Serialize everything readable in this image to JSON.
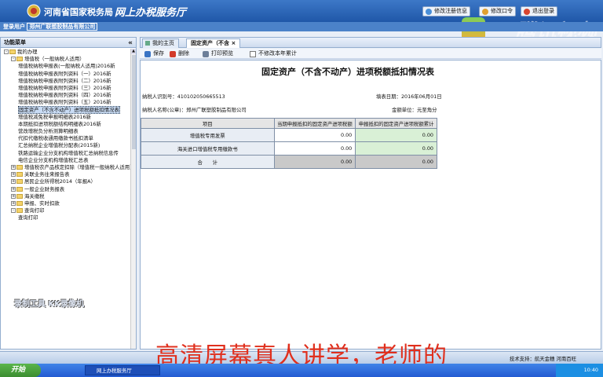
{
  "header": {
    "title1": "河南省国家税务局",
    "title2": "网上办税服务厅",
    "buttons": [
      "修改注册信息",
      "修改口令",
      "退出登录"
    ]
  },
  "user_bar": {
    "label": "登录用户",
    "company": "郑州广联塑胶制品有限公司"
  },
  "sidebar": {
    "title": "功能菜单",
    "items": [
      {
        "label": "我的办理",
        "level": 0,
        "type": "folder",
        "expand": "-"
      },
      {
        "label": "增值税（一般纳税人适用）",
        "level": 1,
        "type": "folder",
        "expand": "-"
      },
      {
        "label": "增值税纳税申报表(一般纳税人适用)2016新",
        "level": 2,
        "type": "doc"
      },
      {
        "label": "增值税纳税申报表附列资料（一）2016新",
        "level": 2,
        "type": "doc"
      },
      {
        "label": "增值税纳税申报表附列资料（二）2016新",
        "level": 2,
        "type": "doc"
      },
      {
        "label": "增值税纳税申报表附列资料（三）2016新",
        "level": 2,
        "type": "doc"
      },
      {
        "label": "增值税纳税申报表附列资料（四）2016新",
        "level": 2,
        "type": "doc"
      },
      {
        "label": "增值税纳税申报表附列资料（五）2016新",
        "level": 2,
        "type": "doc"
      },
      {
        "label": "固定资产（不含不动产）进项税额抵扣情况表",
        "level": 2,
        "type": "doc",
        "selected": true
      },
      {
        "label": "增值税减免税申报明细表2016新",
        "level": 2,
        "type": "doc"
      },
      {
        "label": "本期抵扣进项税额结构明细表2016新",
        "level": 2,
        "type": "doc"
      },
      {
        "label": "营改增税负分析测算明细表",
        "level": 2,
        "type": "doc"
      },
      {
        "label": "代扣代缴税收通用缴款书抵扣清单",
        "level": 2,
        "type": "doc"
      },
      {
        "label": "汇总纳税企业增值税分配表(2015新)",
        "level": 2,
        "type": "doc"
      },
      {
        "label": "铁路运输企业分支机构增值税汇总纳税信息传",
        "level": 2,
        "type": "doc"
      },
      {
        "label": "电信企业分支机构增值税汇总表",
        "level": 2,
        "type": "doc"
      },
      {
        "label": "增值税农产品核定扣除（增值税一般纳税人适用）",
        "level": 1,
        "type": "folder",
        "expand": "+"
      },
      {
        "label": "关联业务往来报告表",
        "level": 1,
        "type": "folder",
        "expand": "+"
      },
      {
        "label": "居民企业所得税2014（年报A）",
        "level": 1,
        "type": "folder",
        "expand": "+"
      },
      {
        "label": "一般企业财务报表",
        "level": 1,
        "type": "folder",
        "expand": "+"
      },
      {
        "label": "海关缴税",
        "level": 1,
        "type": "folder",
        "expand": "+"
      },
      {
        "label": "申报、实时扣款",
        "level": 1,
        "type": "folder",
        "expand": "+"
      },
      {
        "label": "查询打印",
        "level": 1,
        "type": "folder",
        "expand": "-"
      },
      {
        "label": "查询打印",
        "level": 2,
        "type": "doc"
      }
    ]
  },
  "tabs": [
    {
      "label": "我的主页"
    },
    {
      "label": "固定资产（不含"
    }
  ],
  "toolbar": {
    "save": "保存",
    "delete": "删除",
    "print": "打印预览",
    "checkbox": "不修改本年累计"
  },
  "form": {
    "title": "固定资产（不含不动产）进项税额抵扣情况表",
    "taxpayer_id_label": "纳税人识别号：",
    "taxpayer_id": "410102050665513",
    "date_label": "填表日期：",
    "date": "2016年06月01日",
    "taxpayer_name_label": "纳税人名称(公章)：",
    "taxpayer_name": "郑州广联塑胶制品有限公司",
    "unit_label": "金额单位：元至角分",
    "columns": [
      "项目",
      "当期申报抵扣的固定资产进项税额",
      "申报抵扣的固定资产进项税额累计"
    ],
    "rows": [
      {
        "item": "增值税专用发票",
        "current": "0.00",
        "cumulative": "0.00"
      },
      {
        "item": "海关进口增值税专用缴款书",
        "current": "0.00",
        "cumulative": "0.00"
      },
      {
        "item": "合　　计",
        "current": "0.00",
        "cumulative": "0.00"
      }
    ]
  },
  "status": {
    "support": "技术支持：航天金穗 河南百旺"
  },
  "taskbar": {
    "start": "开始",
    "task": "网上办税服务厅",
    "clock": "10:40"
  },
  "overlay": {
    "caption": "高清屏幕真人讲学，老师的",
    "watermark": "腾讯视频",
    "recorder": "录制工具 KK录像机"
  },
  "colors": {
    "header": "#2b65b8",
    "caption": "#e0301e",
    "green_cell": "#d9f0d6"
  }
}
